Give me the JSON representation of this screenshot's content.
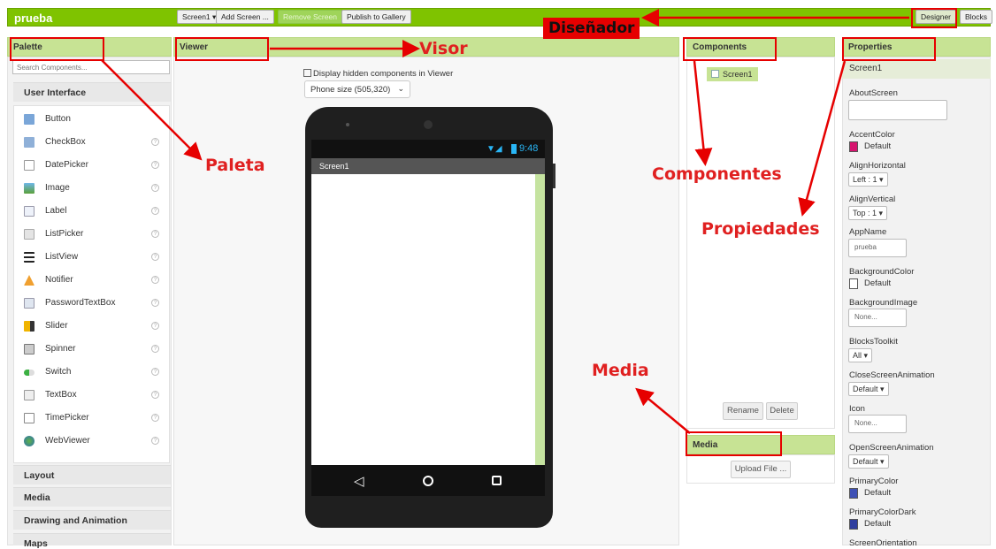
{
  "topbar": {
    "project_name": "prueba",
    "screen_select": "Screen1 ▾",
    "add_screen": "Add Screen ...",
    "remove_screen": "Remove Screen",
    "publish": "Publish to Gallery",
    "designer": "Designer",
    "blocks": "Blocks"
  },
  "palette": {
    "title": "Palette",
    "search_placeholder": "Search Components...",
    "user_interface": "User Interface",
    "items": [
      {
        "label": "Button",
        "icon": "button-icon"
      },
      {
        "label": "CheckBox",
        "icon": "checkbox-icon"
      },
      {
        "label": "DatePicker",
        "icon": "datepicker-icon"
      },
      {
        "label": "Image",
        "icon": "image-icon"
      },
      {
        "label": "Label",
        "icon": "label-icon"
      },
      {
        "label": "ListPicker",
        "icon": "listpicker-icon"
      },
      {
        "label": "ListView",
        "icon": "listview-icon"
      },
      {
        "label": "Notifier",
        "icon": "notifier-icon"
      },
      {
        "label": "PasswordTextBox",
        "icon": "password-icon"
      },
      {
        "label": "Slider",
        "icon": "slider-icon"
      },
      {
        "label": "Spinner",
        "icon": "spinner-icon"
      },
      {
        "label": "Switch",
        "icon": "switch-icon"
      },
      {
        "label": "TextBox",
        "icon": "textbox-icon"
      },
      {
        "label": "TimePicker",
        "icon": "timepicker-icon"
      },
      {
        "label": "WebViewer",
        "icon": "webviewer-icon"
      }
    ],
    "help_glyph": "?",
    "categories": [
      "Layout",
      "Media",
      "Drawing and Animation",
      "Maps"
    ]
  },
  "viewer": {
    "title": "Viewer",
    "hidden_label": "Display hidden components in Viewer",
    "phone_size": "Phone size (505,320)",
    "status_time": "9:48",
    "screen_title": "Screen1"
  },
  "components": {
    "title": "Components",
    "tree_item": "Screen1",
    "rename": "Rename",
    "delete": "Delete"
  },
  "media": {
    "title": "Media",
    "upload": "Upload File ..."
  },
  "properties": {
    "title": "Properties",
    "component": "Screen1",
    "about_screen": "AboutScreen",
    "accent_color": "AccentColor",
    "accent_value": "Default",
    "align_horizontal": "AlignHorizontal",
    "align_horizontal_value": "Left : 1 ▾",
    "align_vertical": "AlignVertical",
    "align_vertical_value": "Top : 1 ▾",
    "app_name": "AppName",
    "app_name_value": "prueba",
    "background_color": "BackgroundColor",
    "background_color_value": "Default",
    "background_image": "BackgroundImage",
    "background_image_value": "None...",
    "blocks_toolkit": "BlocksToolkit",
    "blocks_toolkit_value": "All ▾",
    "close_anim": "CloseScreenAnimation",
    "close_anim_value": "Default ▾",
    "icon": "Icon",
    "icon_value": "None...",
    "open_anim": "OpenScreenAnimation",
    "open_anim_value": "Default ▾",
    "primary_color": "PrimaryColor",
    "primary_color_value": "Default",
    "primary_color_dark": "PrimaryColorDark",
    "primary_color_dark_value": "Default",
    "screen_orientation": "ScreenOrientation"
  },
  "annotations": {
    "disenador": "Diseñador",
    "visor": "Visor",
    "paleta": "Paleta",
    "componentes": "Componentes",
    "propiedades": "Propiedades",
    "media": "Media"
  },
  "colors": {
    "bar_green": "#7fc300",
    "panel_green": "#c7e394",
    "annotation_red": "#e60000",
    "accent": "#d6146e",
    "primary": "#3f51b5",
    "primary_dark": "#303f9f"
  }
}
